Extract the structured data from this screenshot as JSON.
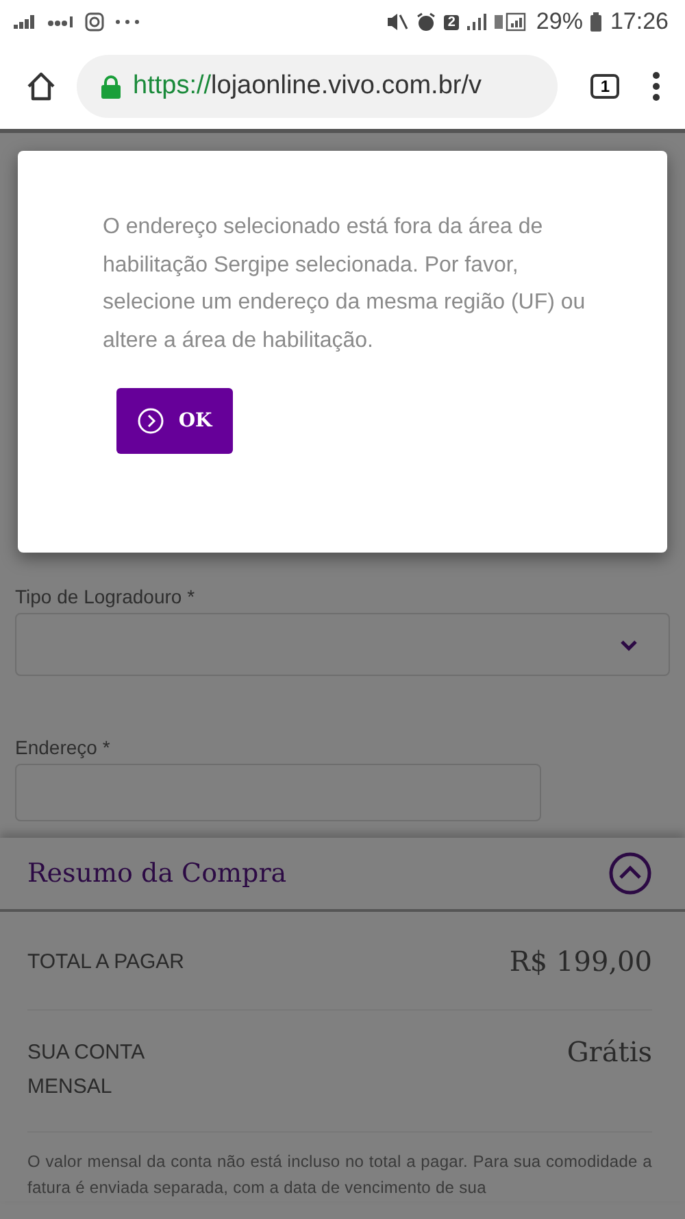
{
  "status_bar": {
    "sim_badge": "2",
    "battery": "29%",
    "time": "17:26"
  },
  "browser": {
    "url_scheme": "https://",
    "url_rest": "lojaonline.vivo.com.br/v",
    "tab_count": "1"
  },
  "form": {
    "fields": [
      {
        "label": "Tipo de Logradouro *",
        "kind": "select"
      },
      {
        "label": "Endereço *",
        "kind": "text"
      }
    ]
  },
  "summary": {
    "title": "Resumo da Compra",
    "expanded": true,
    "rows": [
      {
        "label": "TOTAL A PAGAR",
        "value": "R$ 199,00"
      },
      {
        "label": "SUA CONTA MENSAL",
        "value": "Grátis"
      }
    ],
    "note": "O valor mensal da conta não está incluso no total a pagar. Para sua comodidade a fatura é enviada separada, com a data de vencimento de sua"
  },
  "dialog": {
    "message": "O endereço selecionado está fora da área de habilitação Sergipe selecionada. Por favor, selecione um endereço da mesma região (UF) ou altere a área de habilitação.",
    "button": "OK"
  }
}
